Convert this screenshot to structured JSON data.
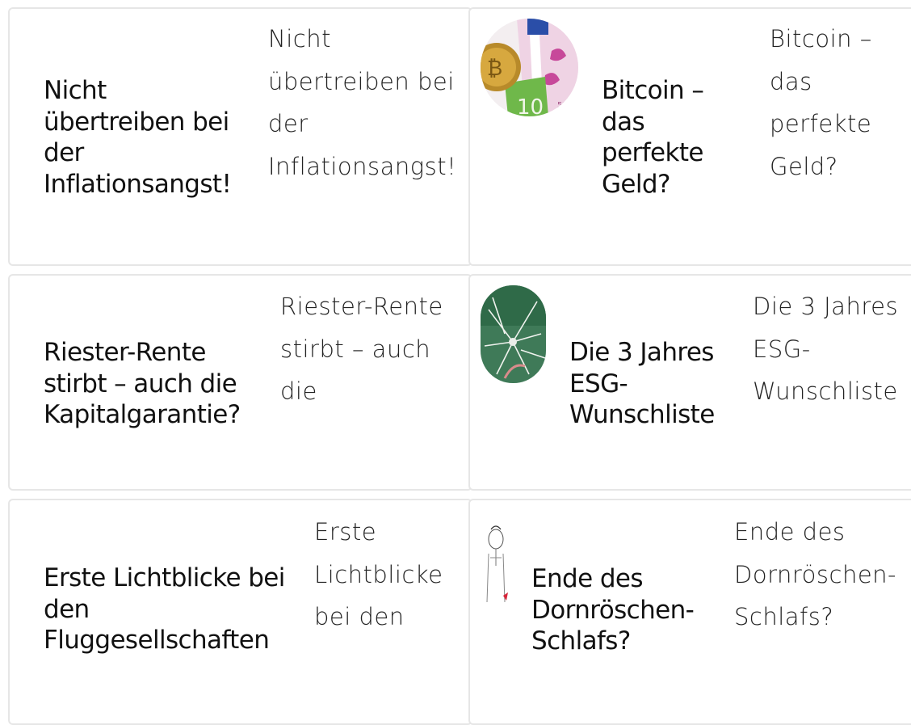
{
  "articles": [
    {
      "title": "Nicht übertreiben bei der Inflationsangst!",
      "excerpt": "Nicht übertreiben bei der Inflationsangst!",
      "thumbnail": ""
    },
    {
      "title": "Bitcoin – das perfekte Geld?",
      "excerpt": "Bitcoin – das perfekte Geld?",
      "thumbnail": "bitcoin-and-euro-banknotes"
    },
    {
      "title": "Riester-Rente stirbt – auch die Kapitalgarantie?",
      "excerpt": "Riester-Rente stirbt – auch die Kapitalgarantie?",
      "thumbnail": ""
    },
    {
      "title": "Die 3 Jahres ESG-Wunschliste",
      "excerpt": "Die 3 Jahres ESG-Wunschliste",
      "thumbnail": "dandelion-seeds"
    },
    {
      "title": "Erste Lichtblicke bei den Fluggesellschaften",
      "excerpt": "Erste Lichtblicke bei den Fluggesellschaften",
      "thumbnail": ""
    },
    {
      "title": "Ende des Dornröschen-Schlafs?",
      "excerpt": "Ende des Dornröschen-Schlafs?",
      "thumbnail": "sketch-portrait"
    }
  ],
  "colors": {
    "border": "#e6e6e6",
    "background": "#ffffff",
    "text": "#111111"
  }
}
